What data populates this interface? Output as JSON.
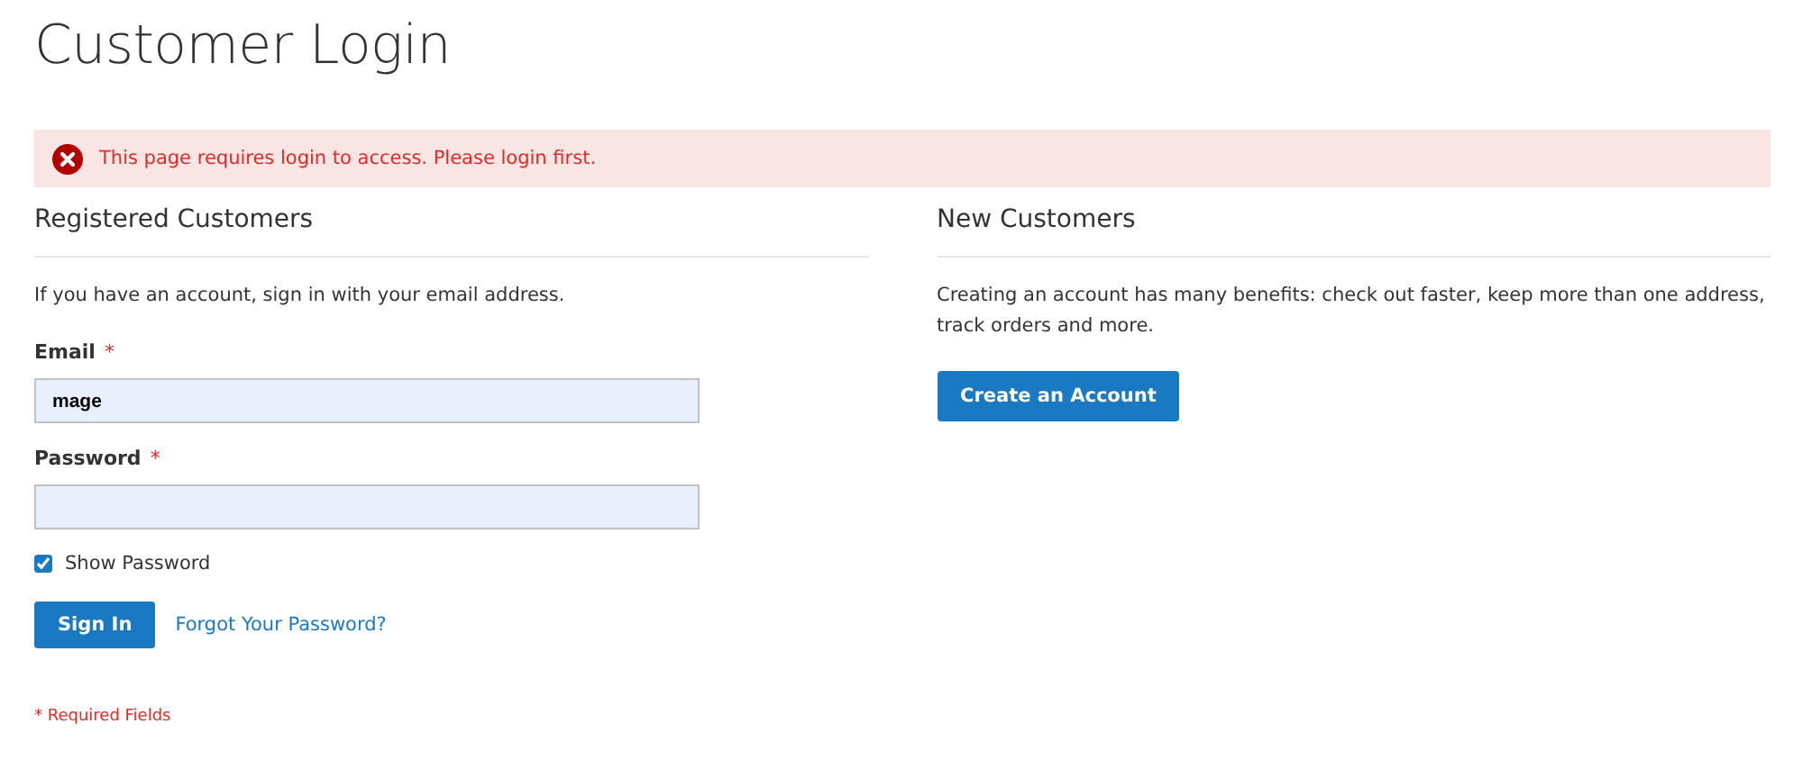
{
  "page_title": "Customer Login",
  "message": {
    "kind": "error",
    "text": "This page requires login to access. Please login first."
  },
  "registered": {
    "heading": "Registered Customers",
    "intro": "If you have an account, sign in with your email address.",
    "fields": [
      {
        "label": "Email",
        "required_mark": "*",
        "value": "mage",
        "kind": "text"
      },
      {
        "label": "Password",
        "required_mark": "*",
        "kind": "password"
      }
    ],
    "show_password": {
      "label": "Show Password",
      "checked": true
    },
    "sign_in": "Sign In",
    "forgot": "Forgot Your Password?",
    "required_note": "* Required Fields"
  },
  "new_customers": {
    "heading": "New Customers",
    "text": "Creating an account has many benefits: check out faster, keep more than one address, track orders and more.",
    "button": "Create an Account"
  }
}
